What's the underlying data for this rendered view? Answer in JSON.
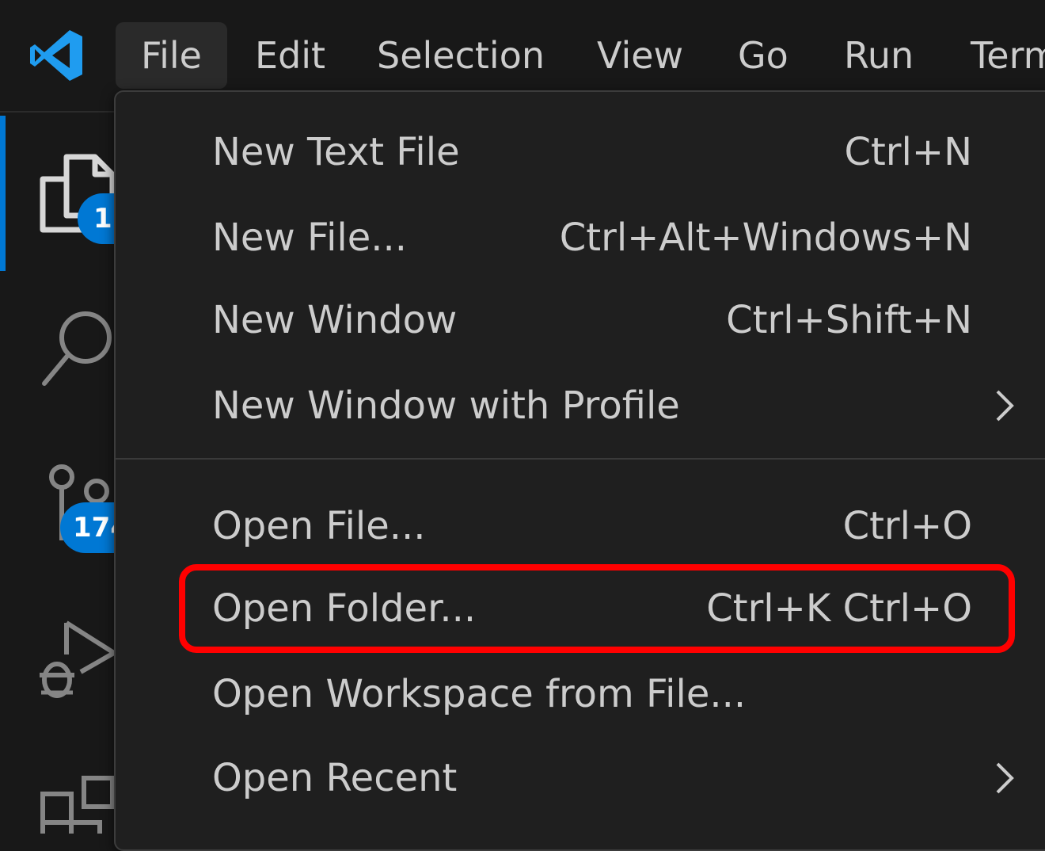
{
  "menubar": {
    "items": [
      {
        "label": "File",
        "active": true
      },
      {
        "label": "Edit"
      },
      {
        "label": "Selection"
      },
      {
        "label": "View"
      },
      {
        "label": "Go"
      },
      {
        "label": "Run"
      },
      {
        "label": "Term"
      }
    ]
  },
  "activity_bar": {
    "icons": [
      "explorer-icon",
      "search-icon",
      "source-control-icon",
      "run-debug-icon",
      "extensions-icon"
    ],
    "explorer_badge": "1",
    "source_control_badge": "174",
    "accent_color": "#0078d4"
  },
  "file_menu": {
    "items": [
      {
        "label": "New Text File",
        "shortcut": "Ctrl+N"
      },
      {
        "label": "New File...",
        "shortcut": "Ctrl+Alt+Windows+N"
      },
      {
        "label": "New Window",
        "shortcut": "Ctrl+Shift+N"
      },
      {
        "label": "New Window with Profile",
        "shortcut": "",
        "submenu": true
      },
      {
        "label": "Open File...",
        "shortcut": "Ctrl+O"
      },
      {
        "label": "Open Folder...",
        "shortcut": "Ctrl+K Ctrl+O",
        "highlighted": true
      },
      {
        "label": "Open Workspace from File...",
        "shortcut": ""
      },
      {
        "label": "Open Recent",
        "shortcut": "",
        "submenu": true
      }
    ]
  },
  "highlight_color": "#ff0000"
}
